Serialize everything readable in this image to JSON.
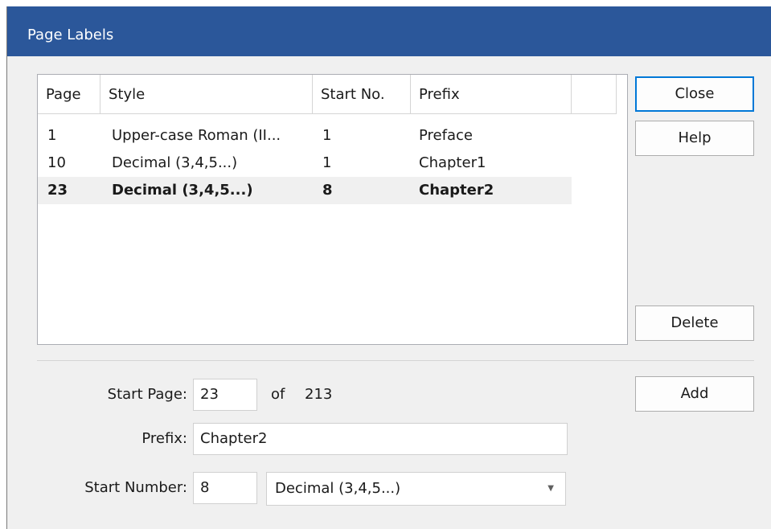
{
  "dialog": {
    "title": "Page Labels"
  },
  "list": {
    "headers": {
      "page": "Page",
      "style": "Style",
      "start_no": "Start No.",
      "prefix": "Prefix"
    },
    "rows": [
      {
        "page": "1",
        "style": "Upper-case Roman (II...",
        "start_no": "1",
        "prefix": "Preface",
        "selected": false
      },
      {
        "page": "10",
        "style": "Decimal (3,4,5...)",
        "start_no": "1",
        "prefix": "Chapter1",
        "selected": false
      },
      {
        "page": "23",
        "style": "Decimal (3,4,5...)",
        "start_no": "8",
        "prefix": "Chapter2",
        "selected": true
      }
    ]
  },
  "buttons": {
    "close": "Close",
    "help": "Help",
    "delete": "Delete",
    "add": "Add"
  },
  "form": {
    "start_page_label": "Start Page:",
    "start_page_value": "23",
    "of_label": "of",
    "total_pages": "213",
    "prefix_label": "Prefix:",
    "prefix_value": "Chapter2",
    "start_number_label": "Start Number:",
    "start_number_value": "8",
    "style_selected": "Decimal (3,4,5...)"
  },
  "colors": {
    "titlebar": "#2b579a",
    "default_button_border": "#0078d7"
  }
}
